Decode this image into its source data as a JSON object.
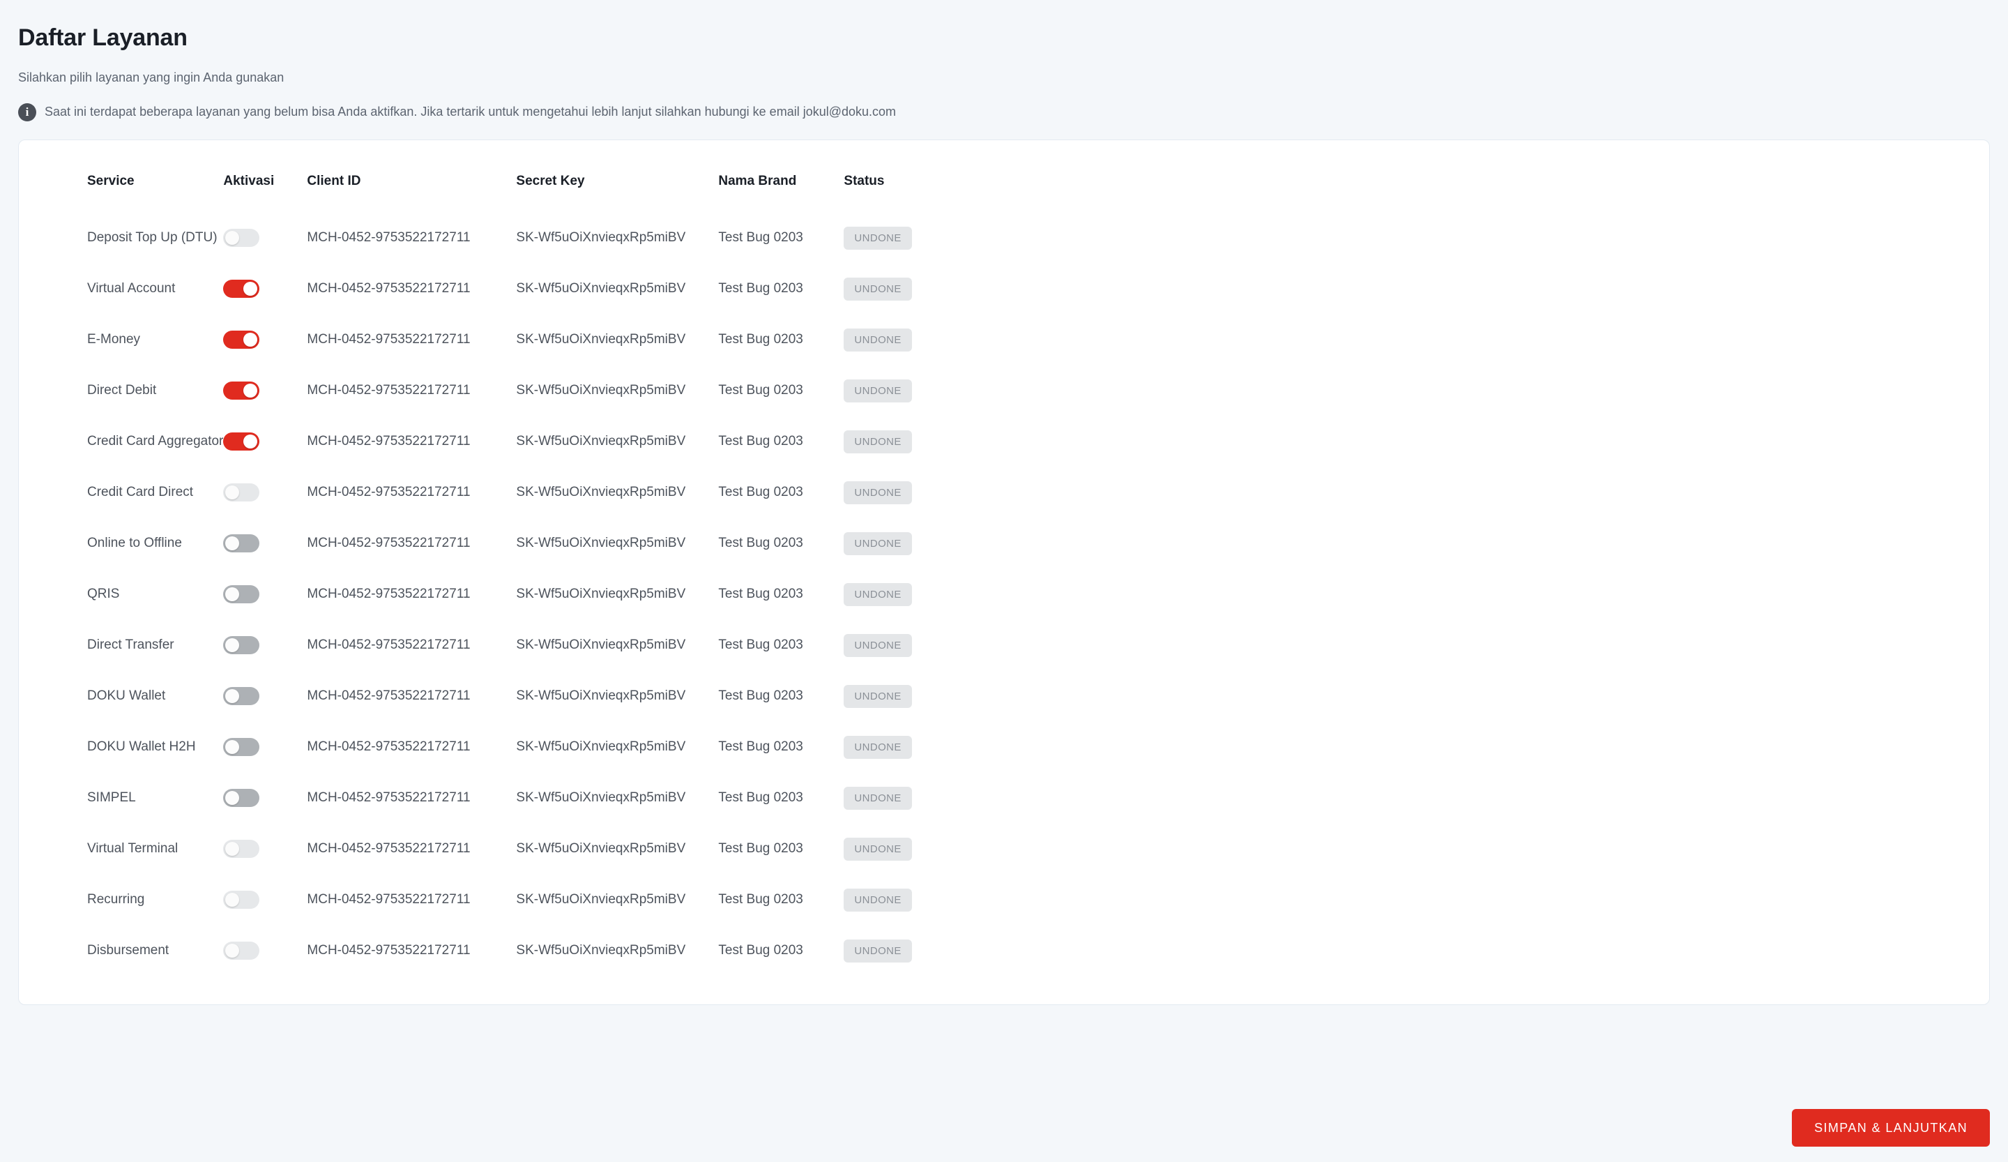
{
  "header": {
    "title": "Daftar Layanan",
    "subtitle": "Silahkan pilih layanan yang ingin Anda gunakan",
    "info_icon": "info-icon",
    "info_text": "Saat ini terdapat beberapa layanan yang belum bisa Anda aktifkan. Jika tertarik untuk mengetahui lebih lanjut silahkan hubungi ke email jokul@doku.com"
  },
  "table": {
    "columns": [
      "Service",
      "Aktivasi",
      "Client ID",
      "Secret Key",
      "Nama Brand",
      "Status"
    ],
    "rows": [
      {
        "service": "Deposit Top Up (DTU)",
        "toggle": "off-disabled",
        "client_id": "MCH-0452-9753522172711",
        "secret_key": "SK-Wf5uOiXnvieqxRp5miBV",
        "brand": "Test Bug 0203",
        "status": "UNDONE"
      },
      {
        "service": "Virtual Account",
        "toggle": "on",
        "client_id": "MCH-0452-9753522172711",
        "secret_key": "SK-Wf5uOiXnvieqxRp5miBV",
        "brand": "Test Bug 0203",
        "status": "UNDONE"
      },
      {
        "service": "E-Money",
        "toggle": "on",
        "client_id": "MCH-0452-9753522172711",
        "secret_key": "SK-Wf5uOiXnvieqxRp5miBV",
        "brand": "Test Bug 0203",
        "status": "UNDONE"
      },
      {
        "service": "Direct Debit",
        "toggle": "on",
        "client_id": "MCH-0452-9753522172711",
        "secret_key": "SK-Wf5uOiXnvieqxRp5miBV",
        "brand": "Test Bug 0203",
        "status": "UNDONE"
      },
      {
        "service": "Credit Card Aggregator",
        "toggle": "on",
        "client_id": "MCH-0452-9753522172711",
        "secret_key": "SK-Wf5uOiXnvieqxRp5miBV",
        "brand": "Test Bug 0203",
        "status": "UNDONE"
      },
      {
        "service": "Credit Card Direct",
        "toggle": "off-disabled",
        "client_id": "MCH-0452-9753522172711",
        "secret_key": "SK-Wf5uOiXnvieqxRp5miBV",
        "brand": "Test Bug 0203",
        "status": "UNDONE"
      },
      {
        "service": "Online to Offline",
        "toggle": "off-enabled",
        "client_id": "MCH-0452-9753522172711",
        "secret_key": "SK-Wf5uOiXnvieqxRp5miBV",
        "brand": "Test Bug 0203",
        "status": "UNDONE"
      },
      {
        "service": "QRIS",
        "toggle": "off-enabled",
        "client_id": "MCH-0452-9753522172711",
        "secret_key": "SK-Wf5uOiXnvieqxRp5miBV",
        "brand": "Test Bug 0203",
        "status": "UNDONE"
      },
      {
        "service": "Direct Transfer",
        "toggle": "off-enabled",
        "client_id": "MCH-0452-9753522172711",
        "secret_key": "SK-Wf5uOiXnvieqxRp5miBV",
        "brand": "Test Bug 0203",
        "status": "UNDONE"
      },
      {
        "service": "DOKU Wallet",
        "toggle": "off-enabled",
        "client_id": "MCH-0452-9753522172711",
        "secret_key": "SK-Wf5uOiXnvieqxRp5miBV",
        "brand": "Test Bug 0203",
        "status": "UNDONE"
      },
      {
        "service": "DOKU Wallet H2H",
        "toggle": "off-enabled",
        "client_id": "MCH-0452-9753522172711",
        "secret_key": "SK-Wf5uOiXnvieqxRp5miBV",
        "brand": "Test Bug 0203",
        "status": "UNDONE"
      },
      {
        "service": "SIMPEL",
        "toggle": "off-enabled",
        "client_id": "MCH-0452-9753522172711",
        "secret_key": "SK-Wf5uOiXnvieqxRp5miBV",
        "brand": "Test Bug 0203",
        "status": "UNDONE"
      },
      {
        "service": "Virtual Terminal",
        "toggle": "off-disabled",
        "client_id": "MCH-0452-9753522172711",
        "secret_key": "SK-Wf5uOiXnvieqxRp5miBV",
        "brand": "Test Bug 0203",
        "status": "UNDONE"
      },
      {
        "service": "Recurring",
        "toggle": "off-disabled",
        "client_id": "MCH-0452-9753522172711",
        "secret_key": "SK-Wf5uOiXnvieqxRp5miBV",
        "brand": "Test Bug 0203",
        "status": "UNDONE"
      },
      {
        "service": "Disbursement",
        "toggle": "off-disabled",
        "client_id": "MCH-0452-9753522172711",
        "secret_key": "SK-Wf5uOiXnvieqxRp5miBV",
        "brand": "Test Bug 0203",
        "status": "UNDONE"
      }
    ]
  },
  "footer": {
    "submit_label": "SIMPAN & LANJUTKAN"
  },
  "colors": {
    "accent_red": "#e02b1f",
    "page_background": "#f4f7fa",
    "card_background": "#ffffff",
    "badge_background": "#e4e6e8",
    "badge_text": "#8b9097"
  }
}
